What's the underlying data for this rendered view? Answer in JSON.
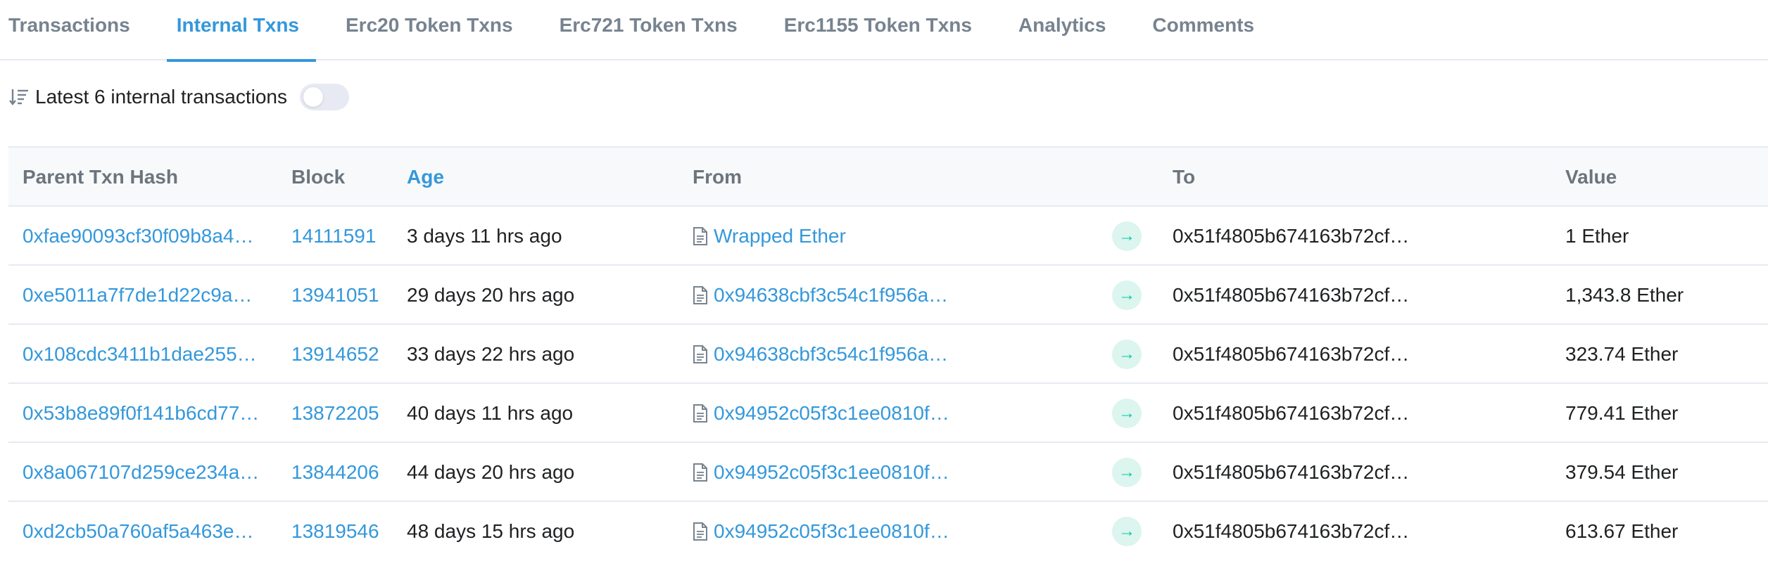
{
  "tabs": [
    {
      "label": "Transactions",
      "active": false
    },
    {
      "label": "Internal Txns",
      "active": true
    },
    {
      "label": "Erc20 Token Txns",
      "active": false
    },
    {
      "label": "Erc721 Token Txns",
      "active": false
    },
    {
      "label": "Erc1155 Token Txns",
      "active": false
    },
    {
      "label": "Analytics",
      "active": false
    },
    {
      "label": "Comments",
      "active": false
    }
  ],
  "summary": {
    "text": "Latest 6 internal transactions",
    "toggle_on": false
  },
  "table": {
    "headers": {
      "hash": "Parent Txn Hash",
      "block": "Block",
      "age": "Age",
      "from": "From",
      "to": "To",
      "value": "Value"
    },
    "rows": [
      {
        "hash": "0xfae90093cf30f09b8a4…",
        "block": "14111591",
        "age": "3 days 11 hrs ago",
        "from": "Wrapped Ether",
        "to": "0x51f4805b674163b72cf…",
        "value": "1 Ether"
      },
      {
        "hash": "0xe5011a7f7de1d22c9a…",
        "block": "13941051",
        "age": "29 days 20 hrs ago",
        "from": "0x94638cbf3c54c1f956a…",
        "to": "0x51f4805b674163b72cf…",
        "value": "1,343.8 Ether"
      },
      {
        "hash": "0x108cdc3411b1dae255…",
        "block": "13914652",
        "age": "33 days 22 hrs ago",
        "from": "0x94638cbf3c54c1f956a…",
        "to": "0x51f4805b674163b72cf…",
        "value": "323.74 Ether"
      },
      {
        "hash": "0x53b8e89f0f141b6cd77…",
        "block": "13872205",
        "age": "40 days 11 hrs ago",
        "from": "0x94952c05f3c1ee0810f…",
        "to": "0x51f4805b674163b72cf…",
        "value": "779.41 Ether"
      },
      {
        "hash": "0x8a067107d259ce234a…",
        "block": "13844206",
        "age": "44 days 20 hrs ago",
        "from": "0x94952c05f3c1ee0810f…",
        "to": "0x51f4805b674163b72cf…",
        "value": "379.54 Ether"
      },
      {
        "hash": "0xd2cb50a760af5a463e…",
        "block": "13819546",
        "age": "48 days 15 hrs ago",
        "from": "0x94952c05f3c1ee0810f…",
        "to": "0x51f4805b674163b72cf…",
        "value": "613.67 Ether"
      }
    ]
  },
  "icons": {
    "sort": "sort-descending-icon",
    "contract": "contract-document-icon",
    "direction": "arrow-right-icon"
  },
  "colors": {
    "accent": "#3498db",
    "in_badge_bg": "#dcf5ee",
    "in_badge_fg": "#00c9a7",
    "muted": "#77838f",
    "border": "#e7eaf3"
  }
}
